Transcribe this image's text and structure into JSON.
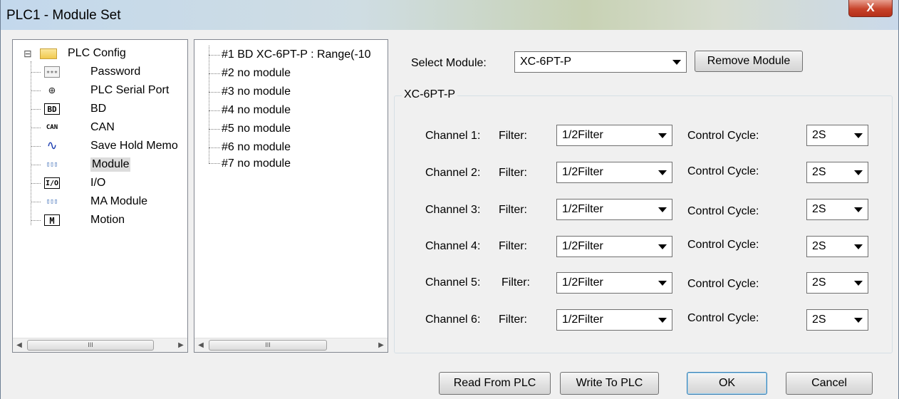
{
  "window": {
    "title": "PLC1 - Module  Set",
    "close_glyph": "X"
  },
  "tree": {
    "root": {
      "label": "PLC Config",
      "icon": "folder-icon",
      "expander": "⊟"
    },
    "items": [
      {
        "label": "Password",
        "icon": "password-icon",
        "glyph": "∗∗∗"
      },
      {
        "label": "PLC Serial Port",
        "icon": "serial-port-icon",
        "glyph": "⊕"
      },
      {
        "label": "BD",
        "icon": "bd-icon",
        "glyph": "BD"
      },
      {
        "label": "CAN",
        "icon": "can-icon",
        "glyph": "CAN"
      },
      {
        "label": "Save Hold Memo",
        "icon": "waveform-icon",
        "glyph": "∿"
      },
      {
        "label": "Module",
        "icon": "module-icon",
        "glyph": "▯▯▯"
      },
      {
        "label": "I/O",
        "icon": "io-icon",
        "glyph": "I/O"
      },
      {
        "label": "MA Module",
        "icon": "ma-module-icon",
        "glyph": "▯▯▯"
      },
      {
        "label": "Motion",
        "icon": "motion-icon",
        "glyph": "M"
      }
    ]
  },
  "slots": [
    "#1 BD XC-6PT-P : Range(-10",
    "#2 no module",
    "#3 no module",
    "#4 no module",
    "#5 no module",
    "#6 no module",
    "#7 no module"
  ],
  "scrollbar": {
    "left": "◀",
    "right": "▶",
    "grip": "III"
  },
  "module": {
    "select_label": "Select Module:",
    "selected": "XC-6PT-P",
    "remove_button": "Remove Module",
    "group_title": "XC-6PT-P"
  },
  "channels": [
    {
      "label": "Channel 1:",
      "filter_label": "Filter:",
      "filter": "1/2Filter",
      "cycle_label": "Control Cycle:",
      "cycle": "2S"
    },
    {
      "label": "Channel 2:",
      "filter_label": "Filter:",
      "filter": "1/2Filter",
      "cycle_label": "Control Cycle:",
      "cycle": "2S"
    },
    {
      "label": "Channel 3:",
      "filter_label": "Filter:",
      "filter": "1/2Filter",
      "cycle_label": "Control Cycle:",
      "cycle": "2S"
    },
    {
      "label": "Channel 4:",
      "filter_label": "Filter:",
      "filter": "1/2Filter",
      "cycle_label": "Control Cycle:",
      "cycle": "2S"
    },
    {
      "label": "Channel 5:",
      "filter_label": "Filter:",
      "filter": "1/2Filter",
      "cycle_label": "Control Cycle:",
      "cycle": "2S"
    },
    {
      "label": "Channel 6:",
      "filter_label": "Filter:",
      "filter": "1/2Filter",
      "cycle_label": "Control Cycle:",
      "cycle": "2S"
    }
  ],
  "footer": {
    "read": "Read From PLC",
    "write": "Write To PLC",
    "ok": "OK",
    "cancel": "Cancel"
  }
}
